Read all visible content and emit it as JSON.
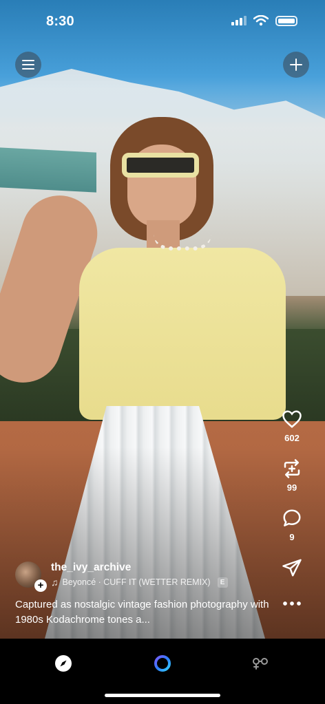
{
  "status_bar": {
    "time": "8:30",
    "icons": [
      "signal-icon",
      "wifi-icon",
      "battery-icon"
    ]
  },
  "top_buttons": {
    "menu_icon": "menu-icon",
    "add_icon": "plus-icon"
  },
  "actions": {
    "like": {
      "icon": "heart-icon",
      "count": "602"
    },
    "repost": {
      "icon": "repost-icon",
      "count": "99"
    },
    "comment": {
      "icon": "comment-icon",
      "count": "9"
    },
    "share": {
      "icon": "send-icon"
    },
    "more": {
      "icon": "more-icon"
    }
  },
  "post": {
    "username": "the_ivy_archive",
    "music": "Beyoncé · CUFF IT (WETTER REMIX)",
    "explicit_badge": "E",
    "caption": "Captured as nostalgic vintage fashion photography with 1980s Kodachrome tones a..."
  },
  "bottom_nav": {
    "items": [
      "explore-icon",
      "create-icon",
      "profile-icon"
    ]
  },
  "colors": {
    "background": "#000000",
    "text": "#ffffff"
  }
}
